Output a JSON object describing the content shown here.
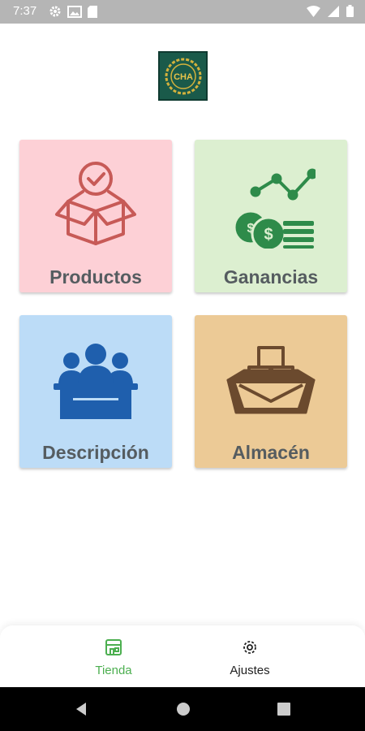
{
  "status_bar": {
    "time": "7:37"
  },
  "cards": [
    {
      "label": "Productos",
      "icon": "box-check-icon",
      "color": "#fdd0d6",
      "icon_color": "#c75a57"
    },
    {
      "label": "Ganancias",
      "icon": "growth-money-icon",
      "color": "#dcefd0",
      "icon_color": "#2e8b4a"
    },
    {
      "label": "Descripción",
      "icon": "team-box-icon",
      "color": "#bcdcf7",
      "icon_color": "#1f5fad"
    },
    {
      "label": "Almacén",
      "icon": "warehouse-crate-icon",
      "color": "#ecca96",
      "icon_color": "#6b4a2e"
    }
  ],
  "bottom_nav": {
    "tienda_label": "Tienda",
    "ajustes_label": "Ajustes",
    "active": "Tienda",
    "active_color": "#4caf50"
  },
  "logo_text": "CHA"
}
